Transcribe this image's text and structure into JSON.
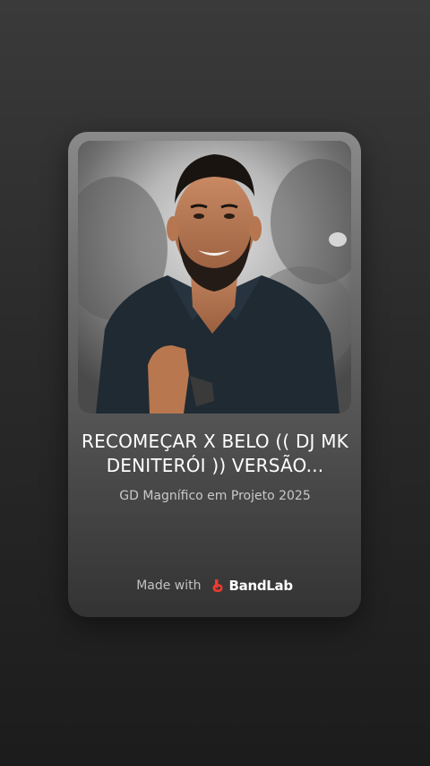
{
  "card": {
    "cover_image": "artist-portrait-icon",
    "title": "RECOMEÇAR X BELO (( DJ MK DENITERÓI )) VERSÃO...",
    "subtitle": "GD Magnífico em Projeto 2025"
  },
  "footer": {
    "made_with_label": "Made with",
    "brand_name": "BandLab",
    "brand_icon": "bandlab-logo-icon",
    "brand_color": "#f03a2f"
  }
}
